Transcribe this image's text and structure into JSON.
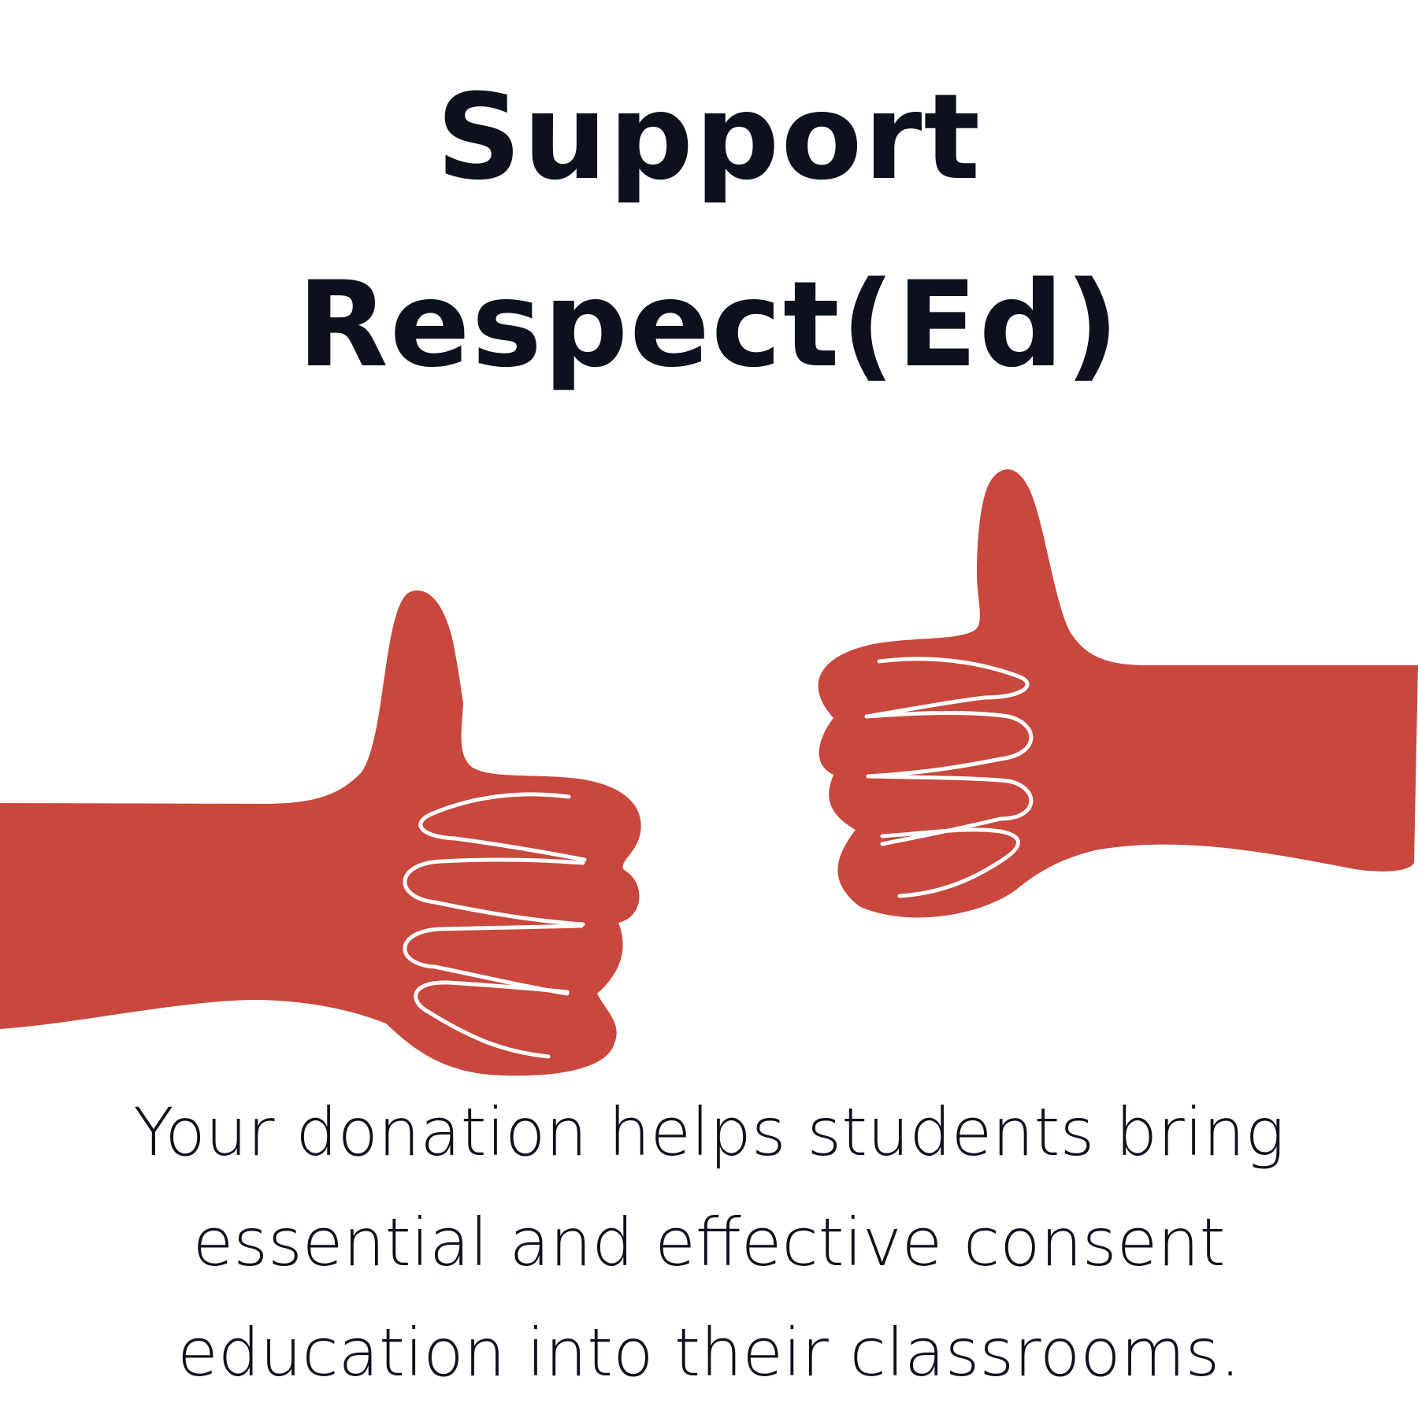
{
  "headline": {
    "line1": "Support",
    "line2": "Respect(Ed)"
  },
  "body": {
    "lines": [
      "Your donation helps students bring",
      "essential and effective consent",
      "education into their classrooms."
    ]
  },
  "illustration": {
    "subject": "two thumbs-up hands",
    "icon": "thumbs-up-icon"
  },
  "colors": {
    "text": "#0d111d",
    "hand_fill": "#c9473c",
    "hand_outline": "#ffffff",
    "background": "#ffffff"
  }
}
